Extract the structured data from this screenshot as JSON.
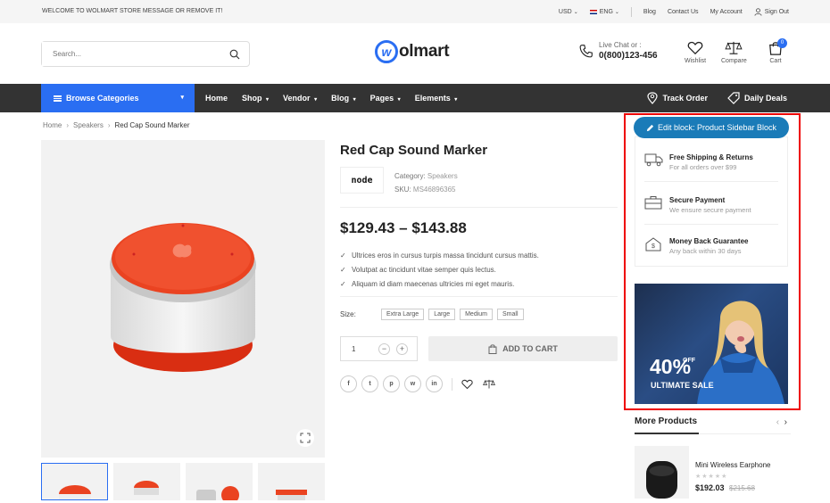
{
  "topbar": {
    "welcome": "WELCOME TO WOLMART STORE MESSAGE OR REMOVE IT!",
    "currency": "USD",
    "language": "ENG",
    "links": [
      "Blog",
      "Contact Us",
      "My Account"
    ],
    "signout": "Sign Out"
  },
  "header": {
    "search_placeholder": "Search...",
    "logo_initial": "w",
    "logo_text": "olmart",
    "livechat_label": "Live Chat or :",
    "phone": "0(800)123-456",
    "wishlist": "Wishlist",
    "compare": "Compare",
    "cart": "Cart",
    "cart_count": "0"
  },
  "nav": {
    "browse": "Browse Categories",
    "items": [
      "Home",
      "Shop",
      "Vendor",
      "Blog",
      "Pages",
      "Elements"
    ],
    "track_order": "Track Order",
    "daily_deals": "Daily Deals"
  },
  "breadcrumb": [
    "Home",
    "Speakers",
    "Red Cap Sound Marker"
  ],
  "product": {
    "title": "Red Cap Sound Marker",
    "brand_logo_text": "node",
    "category_label": "Category:",
    "category": "Speakers",
    "sku_label": "SKU:",
    "sku": "MS46896365",
    "price": "$129.43 – $143.88",
    "bullets": [
      "Ultrices eros in cursus turpis massa tincidunt cursus mattis.",
      "Volutpat ac tincidunt vitae semper quis lectus.",
      "Aliquam id diam maecenas ultricies mi eget mauris."
    ],
    "size_label": "Size:",
    "sizes": [
      "Extra Large",
      "Large",
      "Medium",
      "Small"
    ],
    "quantity": "1",
    "add_to_cart": "ADD TO CART"
  },
  "social": [
    "f",
    "t",
    "p",
    "w",
    "in"
  ],
  "sidebar": {
    "edit_block": "Edit block: Product Sidebar Block",
    "services": [
      {
        "title": "Free Shipping & Returns",
        "subtitle": "For all orders over $99",
        "icon": "truck-icon"
      },
      {
        "title": "Secure Payment",
        "subtitle": "We ensure secure payment",
        "icon": "briefcase-icon"
      },
      {
        "title": "Money Back Guarantee",
        "subtitle": "Any back within 30 days",
        "icon": "money-icon"
      }
    ],
    "banner_percent": "40%",
    "banner_off": "OFF",
    "banner_sale": "ULTIMATE SALE"
  },
  "more_products": {
    "title": "More Products",
    "item_name": "Mini Wireless Earphone",
    "item_price": "$192.03",
    "item_old_price": "$215.68"
  },
  "colors": {
    "accent": "#2a6ef2",
    "nav_bg": "#333333",
    "edit_button": "#1a7bb8",
    "highlight_border": "#ee0000",
    "product_red": "#e8421f"
  }
}
